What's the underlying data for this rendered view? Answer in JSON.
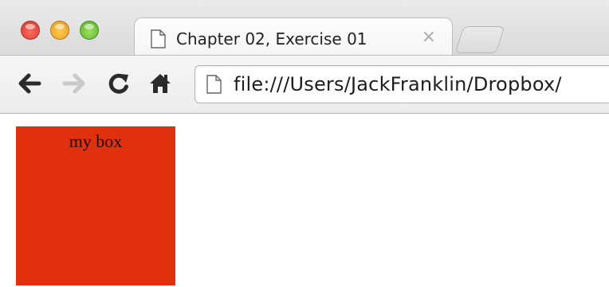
{
  "tab": {
    "title": "Chapter 02, Exercise 01",
    "close_glyph": "×",
    "icon": "document-icon"
  },
  "toolbar": {
    "back_icon": "back-arrow-icon",
    "forward_icon": "forward-arrow-icon",
    "reload_icon": "reload-icon",
    "home_icon": "home-icon"
  },
  "omnibox": {
    "url": "file:///Users/JackFranklin/Dropbox/",
    "icon": "document-icon"
  },
  "page": {
    "box_label": "my box",
    "box_color": "#e0300d"
  },
  "colors": {
    "close": "#e2463d",
    "minimize": "#f0a72a",
    "zoom": "#6bbf3a"
  }
}
